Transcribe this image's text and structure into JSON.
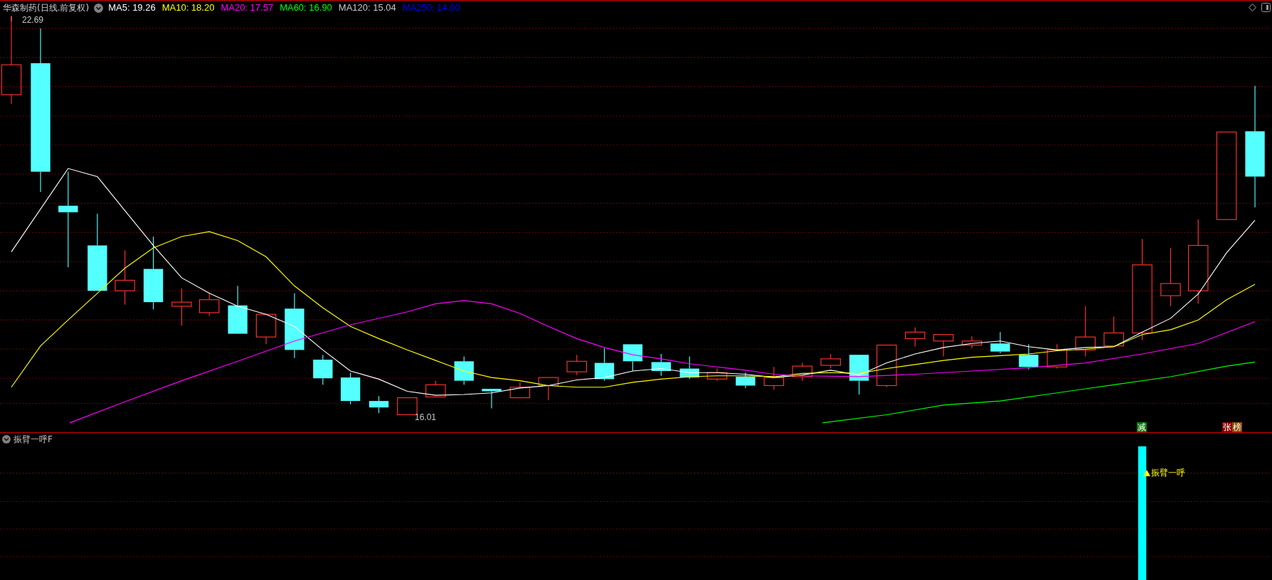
{
  "chart_header": {
    "title": "华森制药(日线.前复权)",
    "legend": [
      {
        "label": "MA5: 19.26",
        "color": "#ffffff"
      },
      {
        "label": "MA10: 18.20",
        "color": "#ffff00"
      },
      {
        "label": "MA20: 17.57",
        "color": "#ff00ff"
      },
      {
        "label": "MA60: 16.90",
        "color": "#00ff00"
      },
      {
        "label": "MA120: 15.04",
        "color": "#c8c8c8"
      },
      {
        "label": "MA250: 14.00",
        "color": "#0000ff"
      }
    ]
  },
  "price_chart": {
    "high_marker": "22.69",
    "low_marker": "16.01",
    "signal_badges": [
      {
        "text": "减",
        "color": "#0a7a0a"
      },
      {
        "text": "张",
        "color": "#8b0000"
      },
      {
        "text": "榜",
        "color": "#8b4a00"
      }
    ]
  },
  "indicator_panel": {
    "title": "振臂一呼F",
    "signal_label": "振臂一呼"
  }
}
